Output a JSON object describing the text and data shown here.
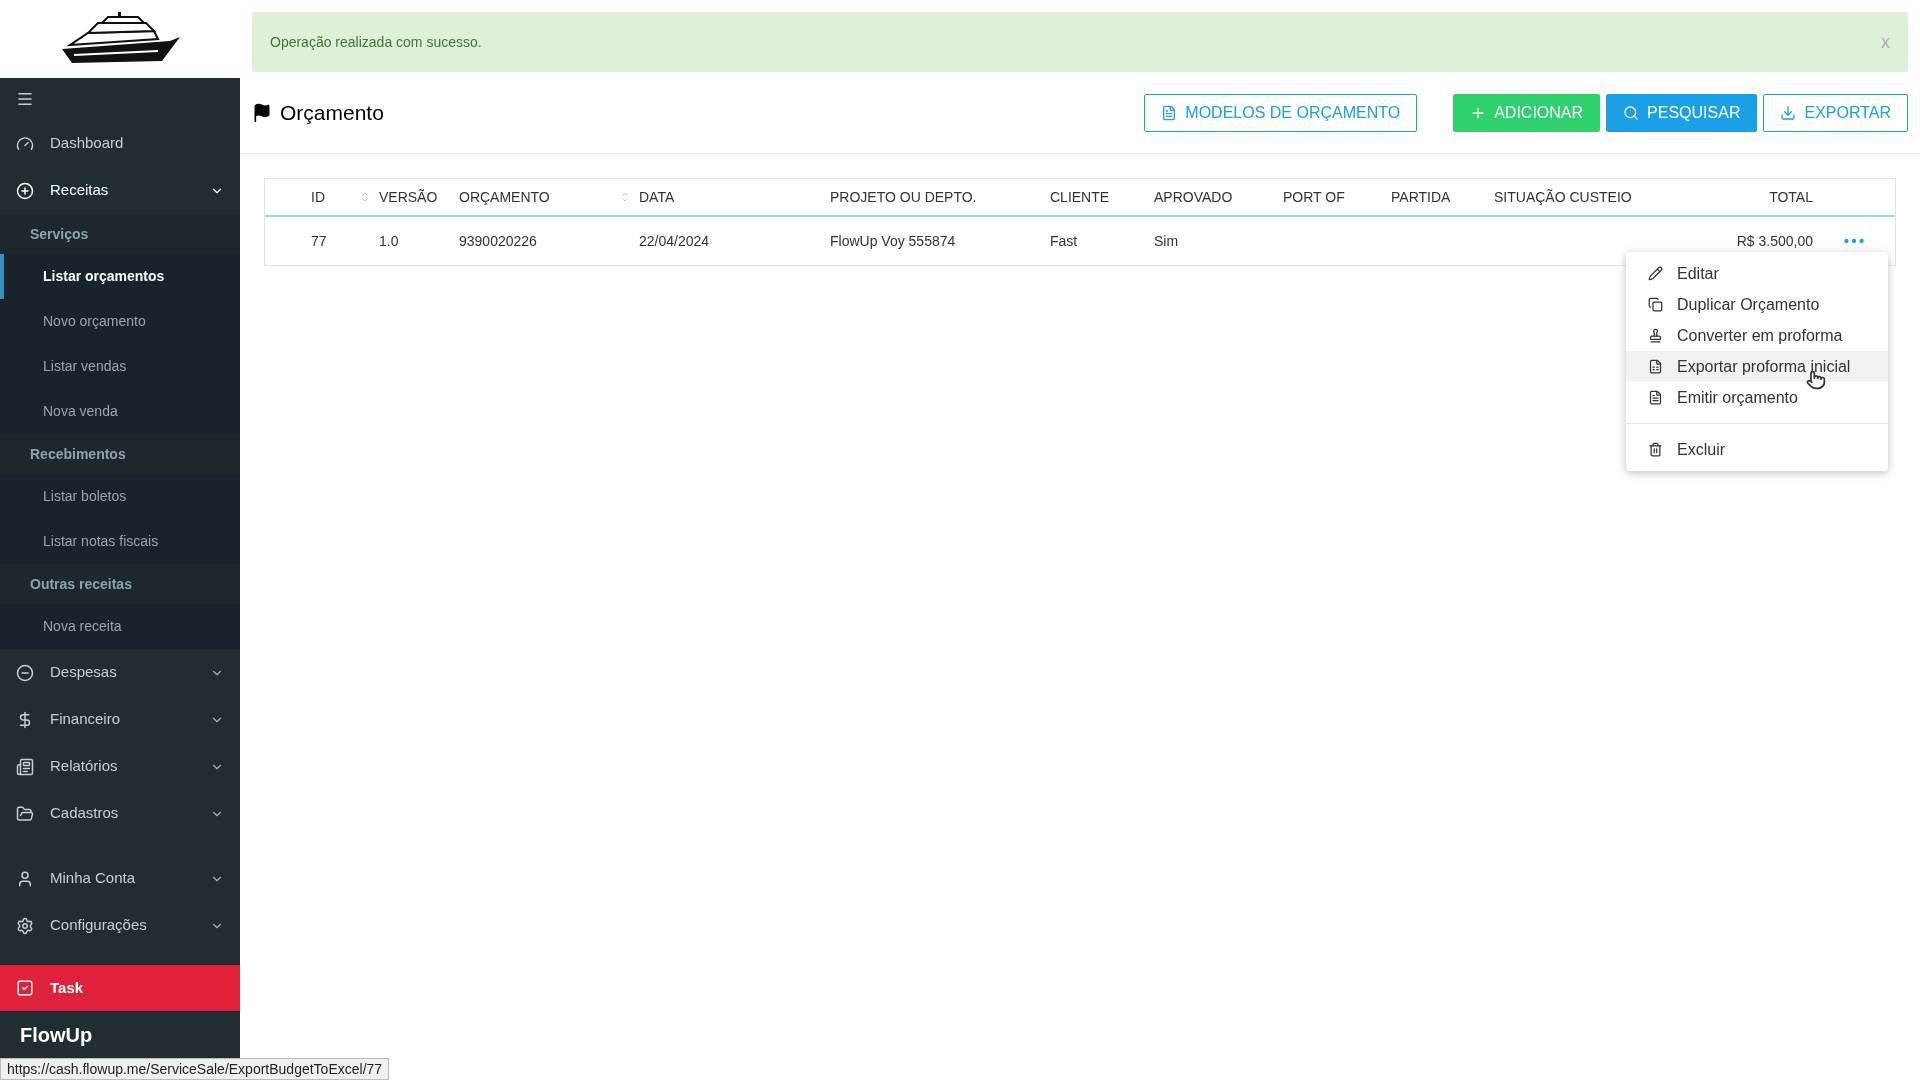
{
  "sidebar": {
    "main_items": [
      {
        "label": "Dashboard"
      },
      {
        "label": "Receitas",
        "expanded": true,
        "groups": [
          {
            "label": "Serviços",
            "items": [
              {
                "label": "Listar orçamentos",
                "selected": true
              },
              {
                "label": "Novo orçamento",
                "selected": false
              },
              {
                "label": "Listar vendas",
                "selected": false
              },
              {
                "label": "Nova venda",
                "selected": false
              }
            ]
          },
          {
            "label": "Recebimentos",
            "items": [
              {
                "label": "Listar boletos",
                "selected": false
              },
              {
                "label": "Listar notas fiscais",
                "selected": false
              }
            ]
          },
          {
            "label": "Outras receitas",
            "items": [
              {
                "label": "Nova receita",
                "selected": false
              }
            ]
          }
        ]
      },
      {
        "label": "Despesas",
        "expanded": false
      },
      {
        "label": "Financeiro",
        "expanded": false
      },
      {
        "label": "Relatórios",
        "expanded": false
      },
      {
        "label": "Cadastros",
        "expanded": false
      }
    ],
    "account_items": [
      {
        "label": "Minha Conta",
        "expanded": false
      },
      {
        "label": "Configurações",
        "expanded": false
      }
    ],
    "task": {
      "label": "Task"
    },
    "brand": "FlowUp"
  },
  "alert": {
    "message": "Operação realizada com sucesso.",
    "close": "x"
  },
  "page": {
    "title": "Orçamento"
  },
  "toolbar": [
    {
      "label": "MODELOS DE ORÇAMENTO",
      "kind": "outline"
    },
    {
      "label": "ADICIONAR",
      "kind": "success"
    },
    {
      "label": "PESQUISAR",
      "kind": "primary"
    },
    {
      "label": "EXPORTAR",
      "kind": "outline"
    }
  ],
  "table": {
    "columns": [
      {
        "label": "ID",
        "sortable": true
      },
      {
        "label": "VERSÃO",
        "sortable": false
      },
      {
        "label": "ORÇAMENTO",
        "sortable": true
      },
      {
        "label": "DATA",
        "sortable": false
      },
      {
        "label": "PROJETO OU DEPTO.",
        "sortable": false
      },
      {
        "label": "CLIENTE",
        "sortable": false
      },
      {
        "label": "APROVADO",
        "sortable": false
      },
      {
        "label": "PORT OF",
        "sortable": false
      },
      {
        "label": "PARTIDA",
        "sortable": false
      },
      {
        "label": "SITUAÇÃO CUSTEIO",
        "sortable": false
      },
      {
        "label": "TOTAL",
        "sortable": false
      }
    ],
    "rows": [
      {
        "cells": [
          "77",
          "1.0",
          "9390020226",
          "22/04/2024",
          "FlowUp Voy 555874",
          "Fast",
          "Sim",
          "",
          "",
          "",
          "R$ 3.500,00"
        ]
      }
    ]
  },
  "row_menu": {
    "groups": [
      [
        {
          "label": "Editar",
          "selected": false
        },
        {
          "label": "Duplicar Orçamento",
          "selected": false
        },
        {
          "label": "Converter em proforma",
          "selected": false
        },
        {
          "label": "Exportar proforma inicial",
          "selected": true
        },
        {
          "label": "Emitir orçamento",
          "selected": false
        }
      ],
      [
        {
          "label": "Excluir",
          "selected": false
        }
      ]
    ]
  },
  "status_url": "https://cash.flowup.me/ServiceSale/ExportBudgetToExcel/77"
}
